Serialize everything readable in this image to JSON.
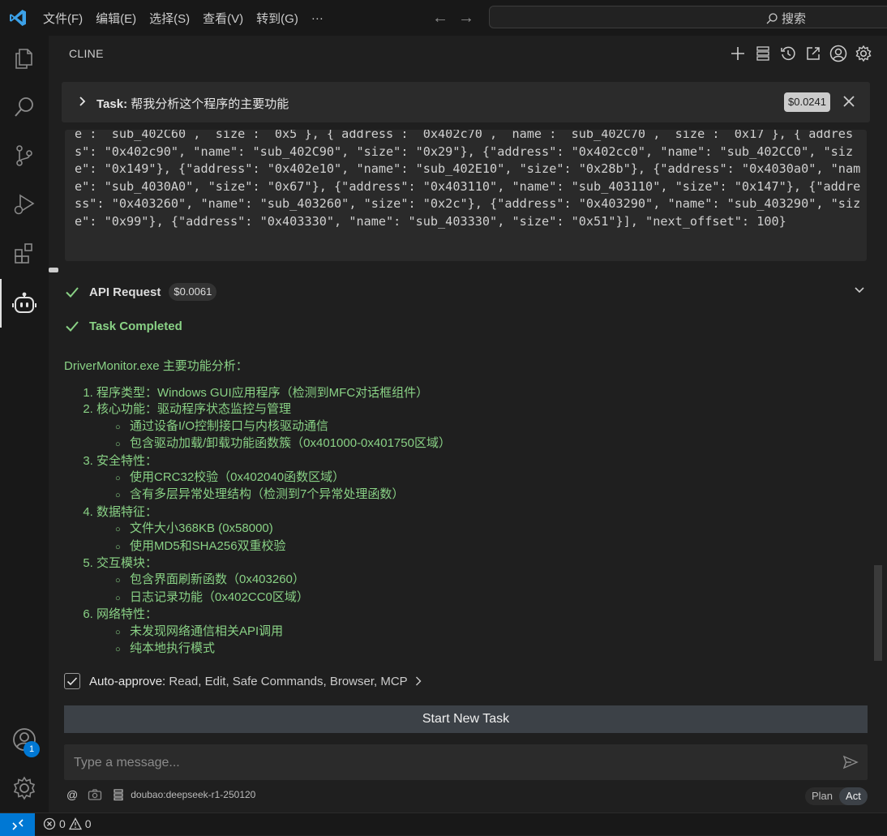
{
  "menu": [
    "文件(F)",
    "编辑(E)",
    "选择(S)",
    "查看(V)",
    "转到(G)",
    "···"
  ],
  "search": {
    "label": "搜索"
  },
  "panel": {
    "title": "CLINE"
  },
  "task": {
    "prefix": "Task:",
    "text": "帮我分析这个程序的主要功能",
    "cost": "$0.0241"
  },
  "code_text": "e :  sub_402C60 ,  size :  0x5 }, { address :  0x402c70 ,  name :  sub_402C70 ,  size :  0x17 }, { address\": \"0x402c90\", \"name\": \"sub_402C90\", \"size\": \"0x29\"}, {\"address\": \"0x402cc0\", \"name\": \"sub_402CC0\", \"size\": \"0x149\"}, {\"address\": \"0x402e10\", \"name\": \"sub_402E10\", \"size\": \"0x28b\"}, {\"address\": \"0x4030a0\", \"name\": \"sub_4030A0\", \"size\": \"0x67\"}, {\"address\": \"0x403110\", \"name\": \"sub_403110\", \"size\": \"0x147\"}, {\"address\": \"0x403260\", \"name\": \"sub_403260\", \"size\": \"0x2c\"}, {\"address\": \"0x403290\", \"name\": \"sub_403290\", \"size\": \"0x99\"}, {\"address\": \"0x403330\", \"name\": \"sub_403330\", \"size\": \"0x51\"}], \"next_offset\": 100}",
  "api_request": {
    "label": "API Request",
    "cost": "$0.0061"
  },
  "task_completed": {
    "label": "Task Completed"
  },
  "result": {
    "heading": "DriverMonitor.exe 主要功能分析：",
    "items": [
      {
        "title": "程序类型：Windows GUI应用程序（检测到MFC对话框组件）",
        "subs": []
      },
      {
        "title": "核心功能：驱动程序状态监控与管理",
        "subs": [
          "通过设备I/O控制接口与内核驱动通信",
          "包含驱动加载/卸载功能函数簇（0x401000-0x401750区域）"
        ]
      },
      {
        "title": "安全特性：",
        "subs": [
          "使用CRC32校验（0x402040函数区域）",
          "含有多层异常处理结构（检测到7个异常处理函数）"
        ]
      },
      {
        "title": "数据特征：",
        "subs": [
          "文件大小368KB (0x58000)",
          "使用MD5和SHA256双重校验"
        ]
      },
      {
        "title": "交互模块：",
        "subs": [
          "包含界面刷新函数（0x403260）",
          "日志记录功能（0x402CC0区域）"
        ]
      },
      {
        "title": "网络特性：",
        "subs": [
          "未发现网络通信相关API调用",
          "纯本地执行模式"
        ]
      }
    ]
  },
  "auto_approve": {
    "label": "Auto-approve:",
    "value": "Read, Edit, Safe Commands, Browser, MCP"
  },
  "start_new_task": "Start New Task",
  "message": {
    "placeholder": "Type a message..."
  },
  "bottom": {
    "at": "@",
    "model": "doubao:deepseek-r1-250120"
  },
  "mode": {
    "plan": "Plan",
    "act": "Act"
  },
  "account_badge": "1",
  "status": {
    "errors": "0",
    "warnings": "0"
  },
  "colors": {
    "accent": "#0078d4",
    "success": "#89d185",
    "background": "#1f1f1f"
  }
}
